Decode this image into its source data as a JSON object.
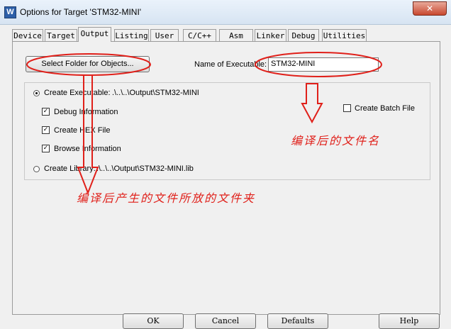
{
  "window": {
    "title": "Options for Target 'STM32-MINI'",
    "icon_label": "W",
    "close_glyph": "✕"
  },
  "tabs": [
    {
      "label": "Device"
    },
    {
      "label": "Target"
    },
    {
      "label": "Output",
      "active": true
    },
    {
      "label": "Listing"
    },
    {
      "label": "User"
    },
    {
      "label": "C/C++"
    },
    {
      "label": "Asm"
    },
    {
      "label": "Linker"
    },
    {
      "label": "Debug"
    },
    {
      "label": "Utilities"
    }
  ],
  "output": {
    "select_folder_label": "Select Folder for Objects...",
    "name_label": "Name of Executable:",
    "name_value": "STM32-MINI",
    "create_executable": {
      "label": "Create Executable:",
      "path": ".\\..\\..\\Output\\STM32-MINI",
      "selected": true
    },
    "debug_information": {
      "label": "Debug Information",
      "checked": true
    },
    "create_hex_file": {
      "label": "Create HEX File",
      "checked": true
    },
    "browse_information": {
      "label": "Browse Information",
      "checked": true
    },
    "create_batch_file": {
      "label": "Create Batch File",
      "checked": false
    },
    "create_library": {
      "label": "Create Library:",
      "path": ".\\..\\..\\Output\\STM32-MINI.lib",
      "selected": false
    }
  },
  "annotations": {
    "executable_name_note": "编译后的文件名",
    "object_folder_note": "编译后产生的文件所放的文件夹",
    "color": "#e0201a"
  },
  "buttons": {
    "ok": "OK",
    "cancel": "Cancel",
    "defaults": "Defaults",
    "help": "Help"
  },
  "check_glyph": "✓"
}
